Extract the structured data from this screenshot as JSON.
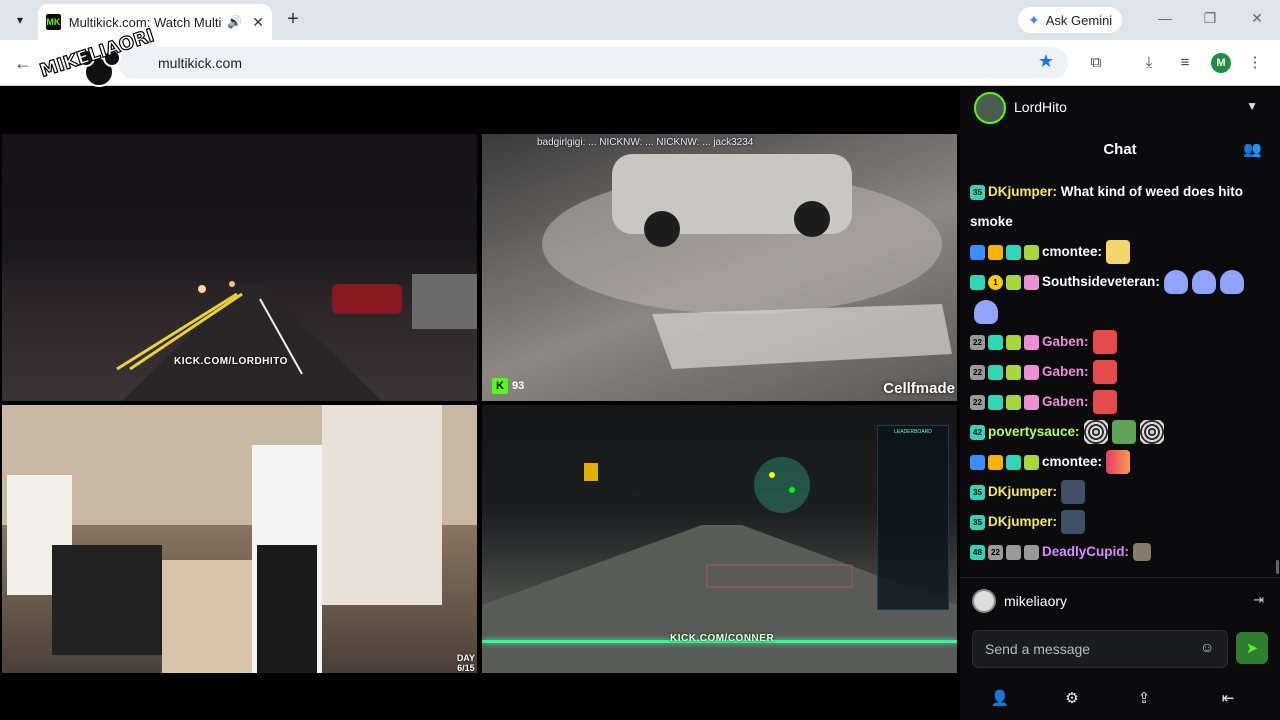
{
  "browser": {
    "tab_title": "Multikick.com: Watch Multi",
    "favicon_text": "MK",
    "new_tab_symbol": "+",
    "ask_gemini": "Ask Gemini",
    "url": "multikick.com",
    "profile_initial": "M",
    "logo_text": "MIKELIAORI"
  },
  "streams": [
    {
      "watermark": "KICK.COM/LORDHITO"
    },
    {
      "top_chat": "badgirlgigi: ... NICKNW: ... NICKNW: ... jack3234",
      "viewer_count": "93",
      "overlay_name": "Cellfmade"
    },
    {
      "day_label": "DAY",
      "day_value": "6/15"
    },
    {
      "watermark": "KICK.COM/CONNER",
      "leaderboard_title": "LEADERBOARD"
    }
  ],
  "chat": {
    "streamer_name": "LordHito",
    "title": "Chat",
    "messages": [
      {
        "badges": [
          "b-sub:35"
        ],
        "user": "DKjumper:",
        "user_color": "#f5e663",
        "text": "What kind of weed does hito smoke",
        "emotes": []
      },
      {
        "badges": [
          "b-blue",
          "b-crown",
          "b-sub",
          "b-plant"
        ],
        "user": "cmontee:",
        "user_color": "#ffffff",
        "text": "",
        "emotes": [
          "e-yellow"
        ]
      },
      {
        "badges": [
          "b-sub",
          "b-gold:1",
          "b-plant",
          "b-gift"
        ],
        "user": "Southsideveteran:",
        "user_color": "#ffffff",
        "text": "",
        "emotes": [
          "e-ghost",
          "e-ghost",
          "e-ghost",
          "e-ghost"
        ]
      },
      {
        "badges": [
          "b-gray:22",
          "b-sub",
          "b-plant",
          "b-gift"
        ],
        "user": "Gaben:",
        "user_color": "#ec8fd6",
        "text": "",
        "emotes": [
          "e-santa"
        ]
      },
      {
        "badges": [
          "b-gray:22",
          "b-sub",
          "b-plant",
          "b-gift"
        ],
        "user": "Gaben:",
        "user_color": "#ec8fd6",
        "text": "",
        "emotes": [
          "e-santa"
        ]
      },
      {
        "badges": [
          "b-gray:22",
          "b-sub",
          "b-plant",
          "b-gift"
        ],
        "user": "Gaben:",
        "user_color": "#ec8fd6",
        "text": "",
        "emotes": [
          "e-santa"
        ]
      },
      {
        "badges": [
          "b-sub:42"
        ],
        "user": "povertysauce:",
        "user_color": "#b6ff5a",
        "text": "",
        "emotes": [
          "e-swirl",
          "e-frog",
          "e-swirl"
        ]
      },
      {
        "badges": [
          "b-blue",
          "b-crown",
          "b-sub",
          "b-plant"
        ],
        "user": "cmontee:",
        "user_color": "#ffffff",
        "text": "",
        "emotes": [
          "e-bars"
        ]
      },
      {
        "badges": [
          "b-sub:35"
        ],
        "user": "DKjumper:",
        "user_color": "#f5e663",
        "text": "",
        "emotes": [
          "e-dark"
        ]
      },
      {
        "badges": [
          "b-sub:35"
        ],
        "user": "DKjumper:",
        "user_color": "#f5e663",
        "text": "",
        "emotes": [
          "e-dark"
        ]
      },
      {
        "badges": [
          "b-sub:48",
          "b-gray:22",
          "b-gray",
          "b-gray"
        ],
        "user": "DeadlyCupid:",
        "user_color": "#d98bff",
        "text": "",
        "emotes": [
          "e-cat"
        ]
      }
    ],
    "current_user": "mikeliaory",
    "input_placeholder": "Send a message"
  },
  "icons": {
    "tab_menu": "chevron-down-icon",
    "audio": "speaker-icon",
    "close": "close-icon",
    "back": "back-arrow-icon",
    "star": "star-icon",
    "extensions": "puzzle-icon",
    "download": "download-icon",
    "media": "media-icon",
    "menu": "kebab-menu-icon",
    "send": "send-icon",
    "emoji": "smile-icon"
  },
  "colors": {
    "kick_green": "#53fc18",
    "chat_bg": "#0b0b0d",
    "send_button": "#2e7d32"
  }
}
